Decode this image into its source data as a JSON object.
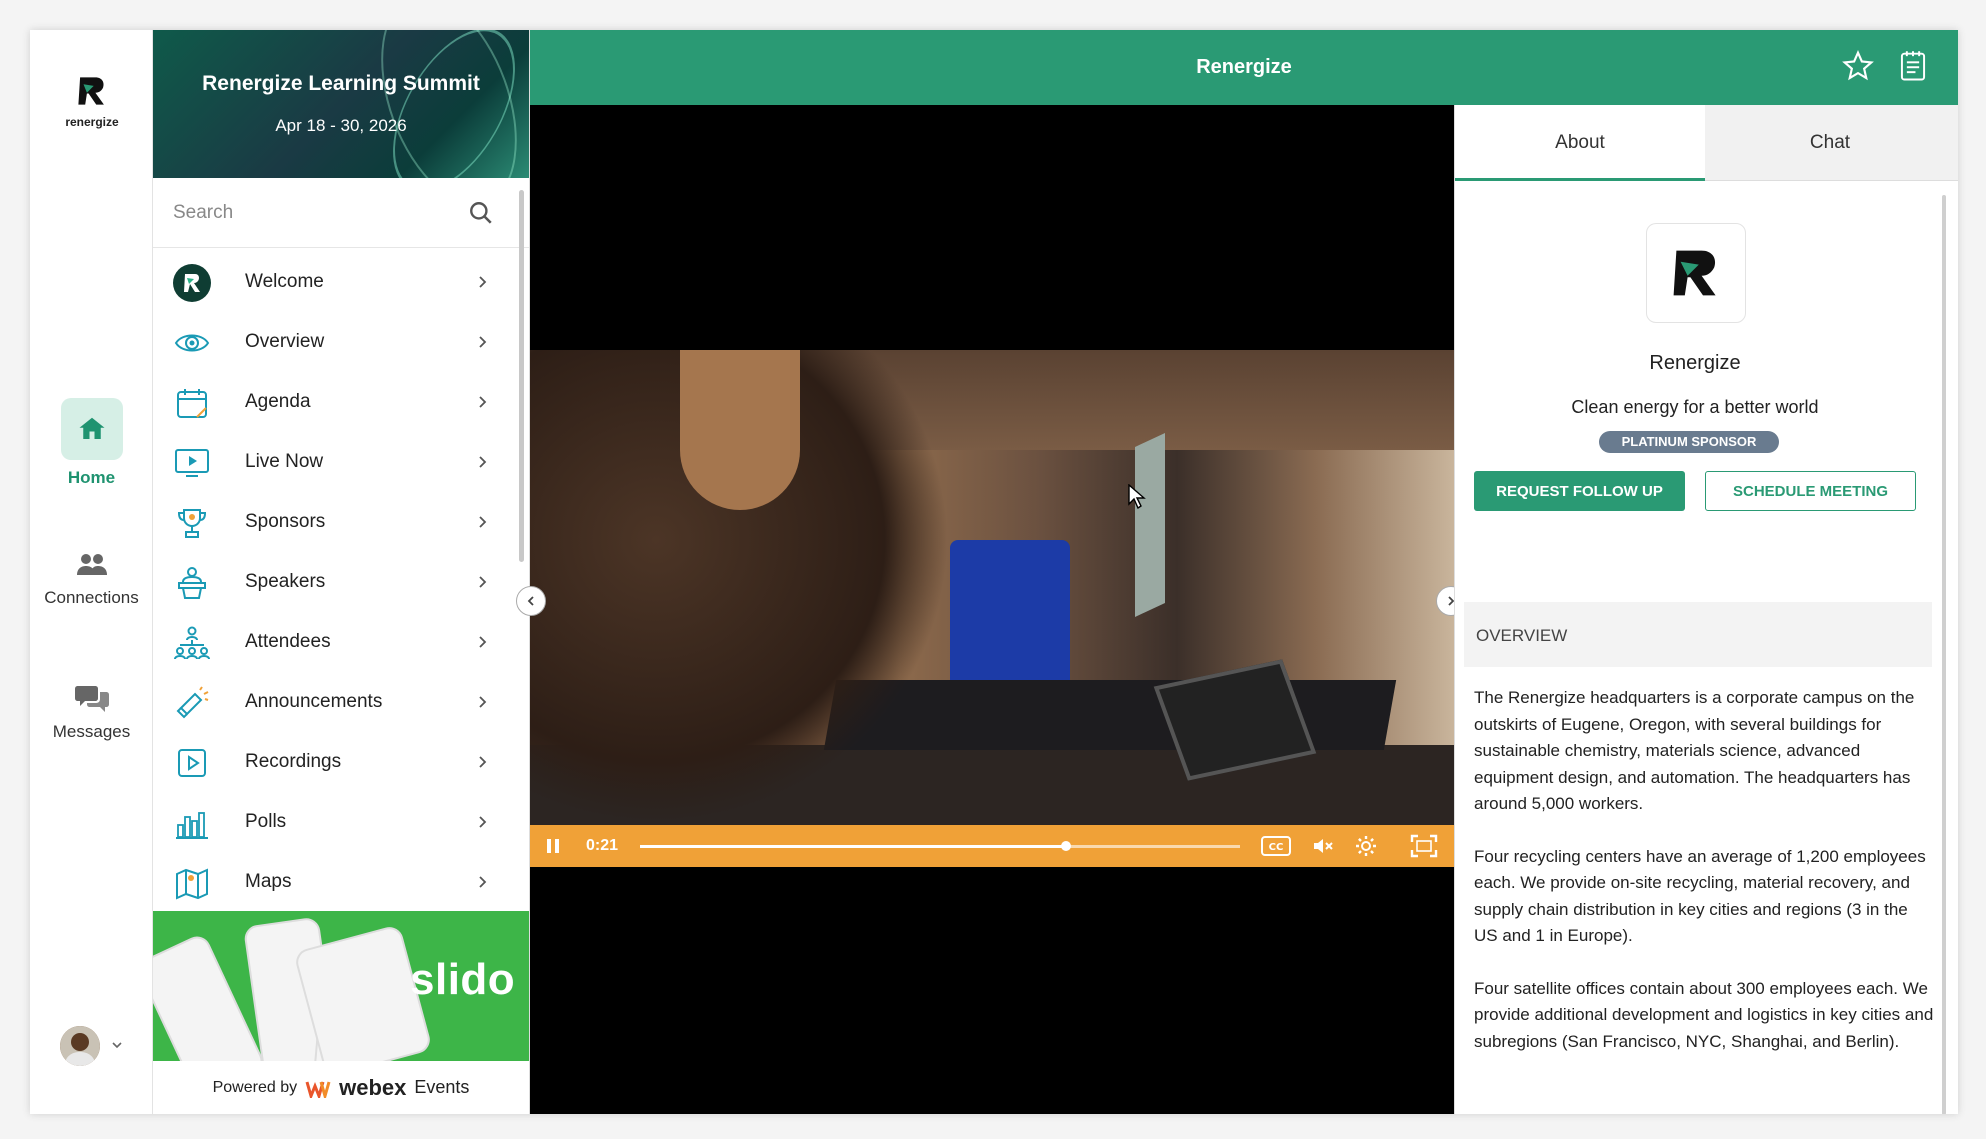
{
  "rail": {
    "logo_text": "renergize",
    "items": [
      {
        "label": "Home",
        "icon": "home-icon",
        "active": true
      },
      {
        "label": "Connections",
        "icon": "people-icon"
      },
      {
        "label": "Messages",
        "icon": "chat-bubbles-icon"
      }
    ]
  },
  "banner": {
    "title": "Renergize Learning Summit",
    "dates": "Apr 18 - 30, 2026"
  },
  "search": {
    "placeholder": "Search"
  },
  "nav": {
    "items": [
      {
        "label": "Welcome",
        "icon": "renergize-logo-icon"
      },
      {
        "label": "Overview",
        "icon": "eye-icon"
      },
      {
        "label": "Agenda",
        "icon": "calendar-icon"
      },
      {
        "label": "Live Now",
        "icon": "monitor-play-icon"
      },
      {
        "label": "Sponsors",
        "icon": "trophy-icon"
      },
      {
        "label": "Speakers",
        "icon": "podium-icon"
      },
      {
        "label": "Attendees",
        "icon": "org-chart-icon"
      },
      {
        "label": "Announcements",
        "icon": "megaphone-icon"
      },
      {
        "label": "Recordings",
        "icon": "play-square-icon"
      },
      {
        "label": "Polls",
        "icon": "bar-chart-icon"
      },
      {
        "label": "Maps",
        "icon": "map-icon"
      }
    ]
  },
  "slido": {
    "word": "slido"
  },
  "powered": {
    "prefix": "Powered by",
    "brand": "webex",
    "suffix": "Events"
  },
  "topbar": {
    "title": "Renergize"
  },
  "video": {
    "time": "0:21",
    "progress": 0.71
  },
  "panel": {
    "tabs": [
      {
        "label": "About",
        "active": true
      },
      {
        "label": "Chat"
      }
    ],
    "org_name": "Renergize",
    "tagline": "Clean energy for a better world",
    "badge": "PLATINUM SPONSOR",
    "btn_follow": "REQUEST FOLLOW UP",
    "btn_meeting": "SCHEDULE MEETING",
    "overview_heading": "OVERVIEW",
    "paragraphs": [
      "The Renergize headquarters is a corporate campus on the outskirts of Eugene, Oregon, with several buildings for sustainable chemistry, materials science, advanced equipment design, and automation. The headquarters has around 5,000 workers.",
      "Four recycling centers have an average of 1,200 employees each. We provide on-site recycling, material recovery, and supply chain distribution in key cities and regions (3 in the US and 1 in Europe).",
      "Four satellite offices contain about 300 employees each. We provide additional development and logistics in key cities and subregions (San Francisco, NYC, Shanghai, and Berlin)."
    ]
  },
  "colors": {
    "brand": "#2a9a74",
    "player": "#f0a137",
    "badge": "#697b8f"
  }
}
